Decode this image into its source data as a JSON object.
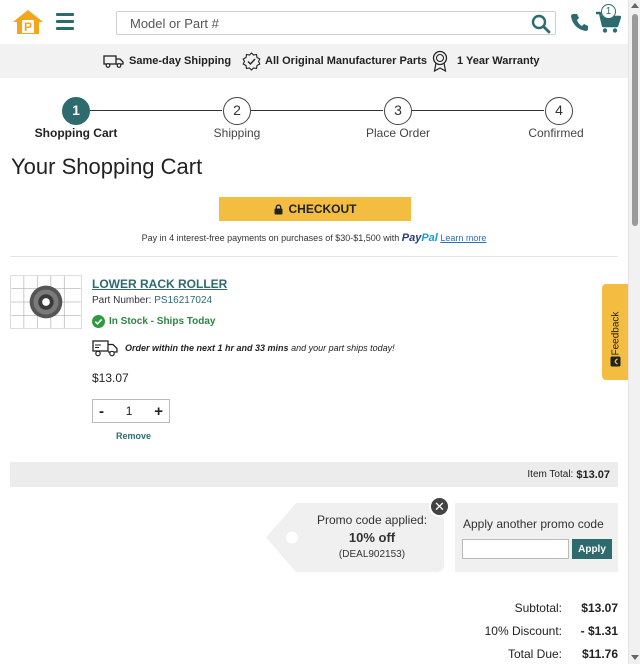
{
  "header": {
    "logo_letter": "P",
    "search_placeholder": "Model or Part #",
    "cart_count": "1",
    "brand_color": "#2d6b6e",
    "accent_color": "#f3bd41"
  },
  "benefits": [
    {
      "label": "Same-day Shipping",
      "icon": "truck-icon"
    },
    {
      "label": "All Original Manufacturer Parts",
      "icon": "badge-check-icon"
    },
    {
      "label": "1 Year Warranty",
      "icon": "award-icon"
    }
  ],
  "steps": [
    {
      "number": "1",
      "label": "Shopping Cart",
      "active": true
    },
    {
      "number": "2",
      "label": "Shipping",
      "active": false
    },
    {
      "number": "3",
      "label": "Place Order",
      "active": false
    },
    {
      "number": "4",
      "label": "Confirmed",
      "active": false
    }
  ],
  "page_title": "Your Shopping Cart",
  "checkout_label": "CHECKOUT",
  "paypal": {
    "text": "Pay in 4 interest-free payments on purchases of $30-$1,500 with",
    "brand_a": "Pay",
    "brand_b": "Pal",
    "learn_more": "Learn more"
  },
  "item": {
    "name": "LOWER RACK ROLLER",
    "part_label": "Part Number:",
    "part_number": "PS16217024",
    "stock": "In Stock - Ships Today",
    "ship_bold": "Order within the next 1 hr and 33 mins",
    "ship_rest": "and your part ships today!",
    "price": "$13.07",
    "quantity": "1",
    "minus": "-",
    "plus": "+",
    "remove": "Remove"
  },
  "item_total": {
    "label": "Item Total:",
    "value": "$13.07"
  },
  "promo": {
    "applied_label": "Promo code applied:",
    "discount": "10% off",
    "code": "(DEAL902153)",
    "close": "✕",
    "another_label": "Apply another promo code",
    "input_value": "",
    "apply_button": "Apply"
  },
  "totals": {
    "subtotal_label": "Subtotal:",
    "subtotal_value": "$13.07",
    "discount_label": "10% Discount:",
    "discount_value": "- $1.31",
    "due_label": "Total Due:",
    "due_value": "$11.76"
  },
  "feedback_label": "Feedback"
}
